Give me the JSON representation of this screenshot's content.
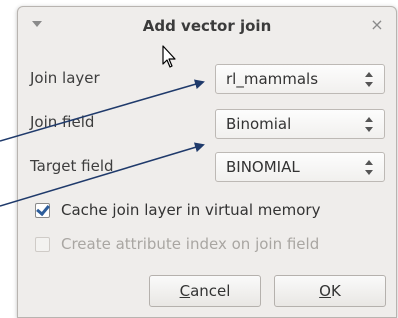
{
  "dialog": {
    "title": "Add vector join",
    "close_glyph": "×"
  },
  "fields": {
    "join_layer": {
      "label": "Join layer",
      "value": "rl_mammals"
    },
    "join_field": {
      "label": "Join field",
      "value": "Binomial"
    },
    "target_field": {
      "label": "Target field",
      "value": "BINOMIAL"
    }
  },
  "options": {
    "cache": {
      "label": "Cache join layer in virtual memory",
      "checked": true,
      "enabled": true
    },
    "index": {
      "label": "Create attribute index on join field",
      "checked": false,
      "enabled": false
    }
  },
  "buttons": {
    "cancel": {
      "mnemonic": "C",
      "rest": "ancel"
    },
    "ok": {
      "mnemonic": "O",
      "rest": "K"
    }
  },
  "icons": {
    "window_menu": "chevron-down-icon",
    "close": "close-icon",
    "spin": "spin-arrows-icon",
    "check": "checkmark-icon",
    "cursor": "mouse-pointer-icon"
  },
  "colors": {
    "dialog_bg": "#efedeb",
    "annotation_arrow": "#1f3a6b",
    "check_accent": "#2d5d9b"
  }
}
